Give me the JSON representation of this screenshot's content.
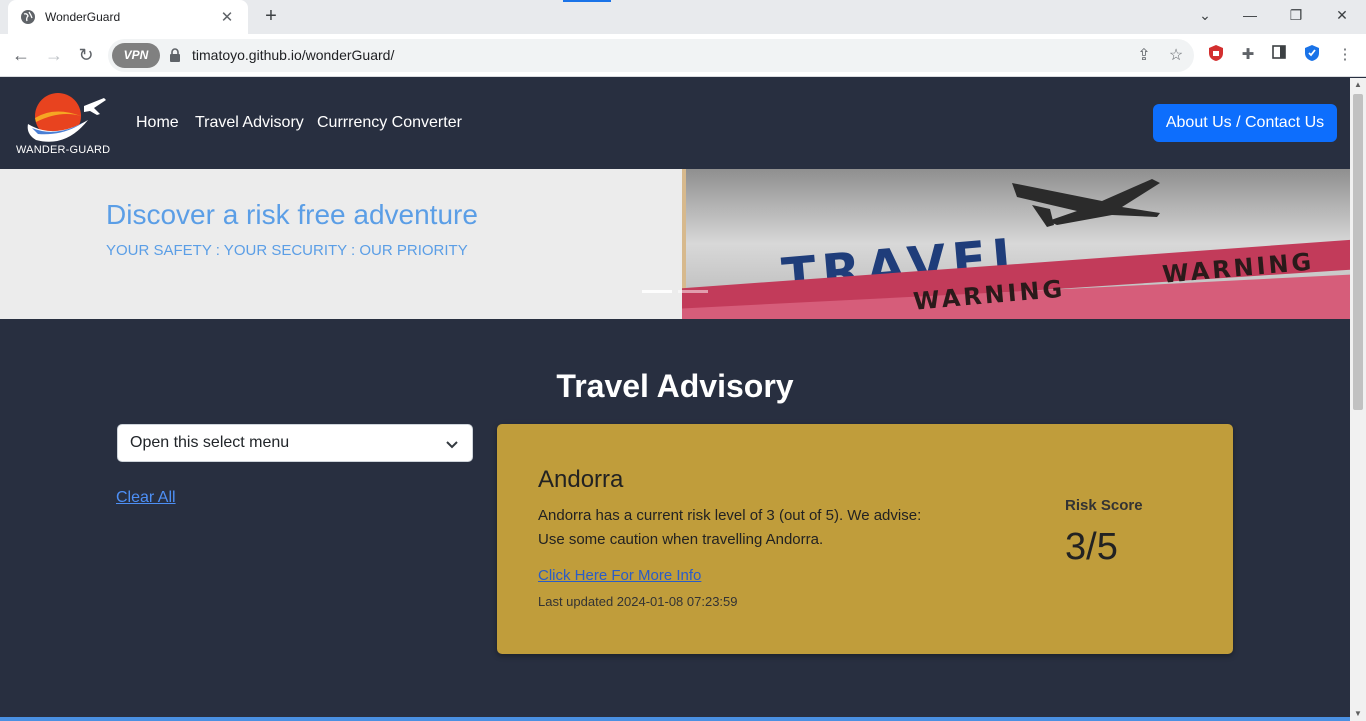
{
  "browser": {
    "tab_title": "WonderGuard",
    "tab_close": "✕",
    "new_tab": "+",
    "vpn_label": "VPN",
    "url": "timatoyo.github.io/wonderGuard/"
  },
  "navbar": {
    "logo_text": "WANDER-GUARD",
    "links": [
      "Home",
      "Travel Advisory",
      "Currrency Converter"
    ],
    "about_button": "About Us / Contact Us"
  },
  "hero": {
    "title": "Discover a risk free adventure",
    "subtitle": "YOUR SAFETY : YOUR SECURITY : OUR PRIORITY",
    "image_words": {
      "travel": "TRAVEL",
      "warning": "WARNING"
    }
  },
  "advisory": {
    "title": "Travel Advisory",
    "select_value": "Open this select menu",
    "clear_all": "Clear All",
    "card": {
      "country": "Andorra",
      "line1": "Andorra has a current risk level of 3 (out of 5). We advise:",
      "line2": "Use some caution when travelling Andorra.",
      "more_info": "Click Here For More Info",
      "updated": "Last updated 2024-01-08 07:23:59",
      "risk_label": "Risk Score",
      "risk_score": "3/5"
    }
  },
  "colors": {
    "page_bg": "#282f40",
    "accent": "#0d6efd",
    "hero_text": "#5b9ee6",
    "card_bg": "#c09d3b"
  }
}
